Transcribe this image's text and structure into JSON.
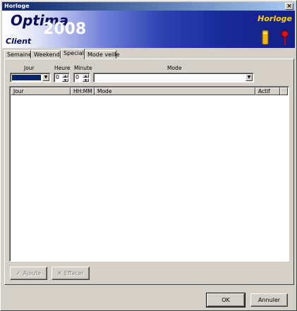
{
  "window": {
    "title": "Horloge",
    "close_glyph": "×"
  },
  "banner": {
    "product": "Optima",
    "year": "2008",
    "edition": "Client",
    "module": "Horloge",
    "icons": [
      "battery-icon",
      "pushpin-icon"
    ],
    "colors": {
      "module_text": "#ffd200",
      "gradient_end": "#121f86"
    }
  },
  "tabs": [
    {
      "label": "Semaine",
      "active": false
    },
    {
      "label": "Weekend",
      "active": false
    },
    {
      "label": "Special",
      "active": true
    },
    {
      "label": "Mode veille",
      "active": false
    }
  ],
  "form": {
    "jour_label": "Jour",
    "heure_label": "Heure",
    "minute_label": "Minute",
    "mode_label": "Mode",
    "heure_value": "0",
    "minute_value": "0",
    "mode_value": ""
  },
  "list": {
    "columns": [
      "Jour",
      "HH:MM",
      "Mode",
      "Actif"
    ],
    "rows": []
  },
  "actions": {
    "ajoute": "Ajoute",
    "effacer": "Effacer"
  },
  "footer": {
    "ok": "OK",
    "annuler": "Annuler"
  }
}
